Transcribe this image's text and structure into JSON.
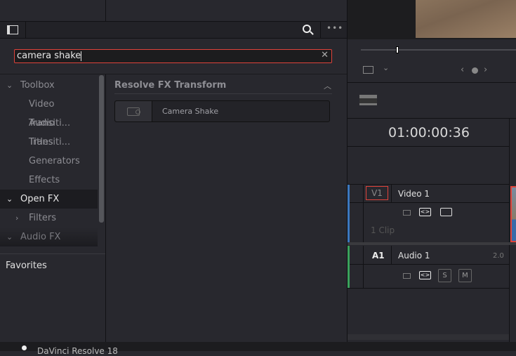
{
  "toolbar": {
    "panel_icon": "panel-toggle-icon",
    "search_icon": "search-icon",
    "more_icon": "more-icon"
  },
  "search": {
    "value": "camera shake",
    "clear_icon": "close-icon"
  },
  "tree": {
    "items": [
      {
        "label": "Toolbox"
      },
      {
        "label": "Video Transiti..."
      },
      {
        "label": "Audio Transiti..."
      },
      {
        "label": "Titles"
      },
      {
        "label": "Generators"
      },
      {
        "label": "Effects"
      },
      {
        "label": "Open FX"
      },
      {
        "label": "Filters"
      },
      {
        "label": "Audio FX"
      }
    ],
    "favorites": "Favorites"
  },
  "results": {
    "group": "Resolve FX Transform",
    "items": [
      {
        "label": "Camera Shake"
      }
    ]
  },
  "timeline": {
    "timecode": "01:00:00:36",
    "video_track": {
      "id": "V1",
      "name": "Video 1",
      "clips": "1 Clip",
      "color": "#3b78c0"
    },
    "audio_track": {
      "id": "A1",
      "name": "Audio 1",
      "channels": "2.0",
      "solo": "S",
      "mute": "M",
      "color": "#3aa35c"
    }
  },
  "statusbar": {
    "app": "DaVinci Resolve 18"
  },
  "colors": {
    "accent": "#e0433b"
  }
}
